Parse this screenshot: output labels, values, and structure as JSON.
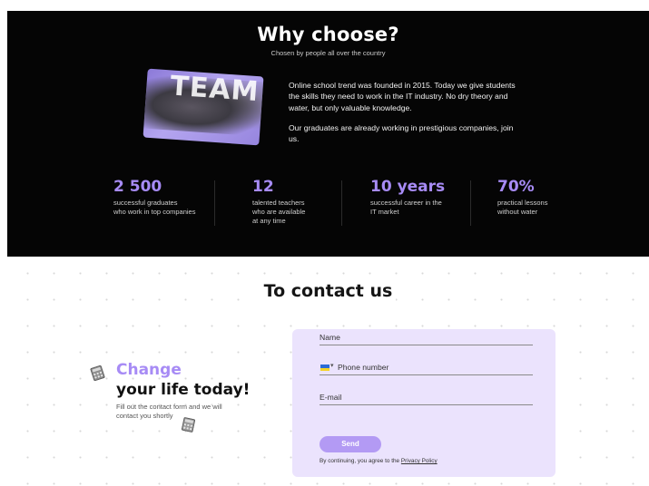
{
  "why": {
    "title": "Why choose?",
    "subtitle": "Chosen by people all over the country",
    "photo_text": "TEAM",
    "about_p1": "Online school trend was founded in 2015. Today we give students the skills they need to work in the IT industry. No dry theory and water, but only valuable knowledge.",
    "about_p2": "Our graduates are already working in prestigious companies, join us."
  },
  "stats": [
    {
      "value": "2 500",
      "line1": "successful graduates",
      "line2": "who work in top companies",
      "line3": ""
    },
    {
      "value": "12",
      "line1": "talented teachers",
      "line2": "who are available",
      "line3": "at any time"
    },
    {
      "value": "10 years",
      "line1": "successful career in the",
      "line2": "IT market",
      "line3": ""
    },
    {
      "value": "70%",
      "line1": "practical lessons",
      "line2": "without water",
      "line3": ""
    }
  ],
  "contact": {
    "title": "To contact us",
    "lead_line1": "Change",
    "lead_line2": "your life today!",
    "lead_text": "Fill out the contact form and we will contact you shortly"
  },
  "form": {
    "name_placeholder": "Name",
    "phone_placeholder": "Phone number",
    "email_placeholder": "E-mail",
    "send_label": "Send",
    "agree_text": "By continuing, you agree to the",
    "privacy_link": "Privacy Policy"
  },
  "colors": {
    "accent": "#a78bf5",
    "form_bg": "#ebe3fd",
    "dark_bg": "#050505"
  },
  "icons": {
    "flag": "ukraine-flag-icon",
    "deco_left": "calculator-icon",
    "deco_right": "calculator-icon"
  }
}
